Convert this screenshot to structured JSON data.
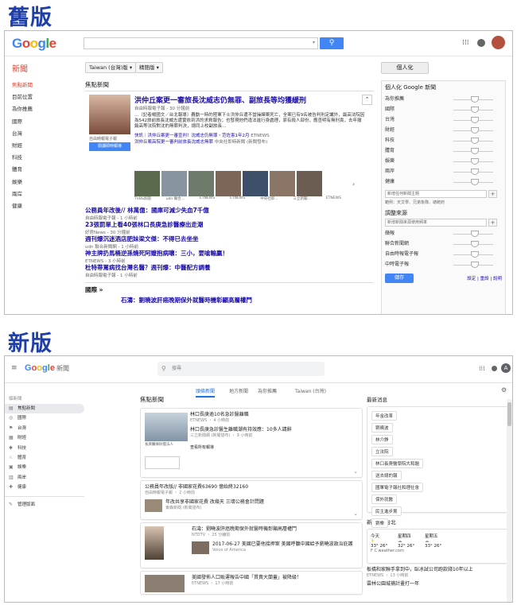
{
  "labels": {
    "old": "舊版",
    "new": "新版"
  },
  "old": {
    "logo": "Google",
    "news_label": "新聞",
    "edition": "Taiwan (台灣)版",
    "edition_mode": "精簡版",
    "personalize_btn": "個人化",
    "sidebar": [
      "焦點新聞",
      "目前位置",
      "為你推薦",
      "國際",
      "台灣",
      "財經",
      "科技",
      "體育",
      "娛樂",
      "兩岸",
      "健康"
    ],
    "top_heading": "焦點新聞",
    "lead": {
      "title": "洪仲丘案更一審旅長沈威志仍無罪、副旅長等均獲緩刑",
      "source": "自由時報電子報 - 30 分鐘前",
      "snippet": "...〔記者楊國文／台北報導〕轟動一時的陸軍下士洪仲丘遭不當操練案死亡，全案已有9名被告判刑定讞外，最高法院因為542旅前旅長沈威志遭實依到洪的求救報告；也發現他們違法進行身處理，原有殺人部份，應查明有無刑責，去年撤銷高等法院對沈的無罪判決，總同上校副旅長...",
      "photo_source": "自由時報電子報",
      "realtime_btn": "閱讀即時報導",
      "quick": "快訊｜洪仲丘案更一審宣判！沈威志仍無罪・范佐憲1年2月",
      "quick_src": "ETNEWS",
      "related": "洪仲丘案高院更一審判前旅長沈威志無罪",
      "related_src": "中央社即時新聞 (新聞發布)",
      "thumbs": [
        "TVBS新聞",
        "udn 聯合...",
        "ETNEWS",
        "ETNEWS",
        "中央社即...",
        "三立新聞...",
        "ETNEWS"
      ]
    },
    "stories": [
      {
        "title": "公務員年改後// 林萬億：國庫可減少失血7千億",
        "src": "自由時報電子報 - 1 小時前"
      },
      {
        "title": "23張罰單上看40張林口長庚急診醫療出走潮",
        "src": "好房News - 30 分鐘前"
      },
      {
        "title": "週刊爆沉迷酒店肥妹梁文傑：不得已去坐坐",
        "src": "udn 聯合新聞網 - 1 小時前"
      },
      {
        "title": "神主牌扔馬桶逆孫燒死阿嬤抱病嚷：三小，要嗆輸贏！",
        "src": "ETNEWS - 3 小時前"
      },
      {
        "title": "杜特蒂罵病找台灣名醫？週刊爆：中醫配方調養",
        "src": "自由時報電子報 - 1 小時前"
      }
    ],
    "intl_heading": "國際 »",
    "intl_story": "石濤：劉曉波肝癌晚期保外就醫時機彰顯高層權鬥",
    "personal_title": "個人化 Google 新聞",
    "sliders": [
      "為你推薦",
      "國際",
      "台灣",
      "財經",
      "科技",
      "體育",
      "娛樂",
      "兩岸",
      "健康"
    ],
    "add_topic_ph": "新增任何新聞主題",
    "add_topic_eg": "範例：天文學、兄弟象隊、總統府",
    "sources_title": "調整來源",
    "add_source_ph": "新增新聞來源使用頻率",
    "source_sliders": [
      "蘋報",
      "聯合新聞網",
      "自由時報電子報",
      "中時電子報"
    ],
    "save_btn": "儲存",
    "settings": "設定",
    "reset": "重設",
    "help": "說明"
  },
  "new": {
    "logo": "Google",
    "logo_sub": "新聞",
    "search_ph": "搜尋",
    "tabs": [
      "頭條新聞",
      "地方新聞",
      "為你推薦",
      "Taiwan (台灣)"
    ],
    "sidebar_caption": "個新聞",
    "sidebar": [
      "焦點新聞",
      "國際",
      "台灣",
      "財經",
      "科技",
      "體育",
      "娛樂",
      "兩岸",
      "健康"
    ],
    "manage": "管理版面",
    "heading": "焦點新聞",
    "cards": [
      {
        "title": "林口長庚逾10名急診醫離職",
        "src": "ETNEWS ・ 4 小時前",
        "sub": "林口長庚急診醫生離職潮有持效應：10多人請辭",
        "sub_src": "三立新聞網 (新聞發布) ・ 9 小時前",
        "more": "查看所有報導",
        "photo_cap": "長庚醫療財團法人"
      },
      {
        "title": "公務員年改版// 非國家花費63690 億始終32160",
        "src": "自由時報電子報 ・ 2 小時前",
        "sub": "年改共享非國家花費 改幾天 三壞公務會計問題",
        "sub_src": "東森新聞 (新聞發布)"
      },
      {
        "title": "石濤：劉曉波肝癌晚期保外就醫時機彰顯高層權鬥",
        "src": "NTDTV ・ 25 分鐘前",
        "sub": "2017-06-27 美國已要他接押案 美國呼籲中國給予劉曉波政治庇護",
        "sub_src": "Voice of America"
      },
      {
        "title": "美國發佈人口販運報告中國「貫責大蘭蓋」被降級！",
        "src": "ETNEWS ・ 17 小時前"
      }
    ],
    "latest_title": "最新消息",
    "latest": [
      "年金改革",
      "劉曉波",
      "林介錚",
      "立法院",
      "林口長庚醫學院大和題",
      "送去總的報",
      "國軍電子報社和理社會",
      "保外就醫",
      "民主進步黨",
      "劉樂"
    ],
    "weather_title": "新北市, 台北",
    "weather_days": [
      "今天",
      "星期四",
      "星期五"
    ],
    "weather_temps": [
      "33° 26°",
      "32° 26°",
      "33° 26°"
    ],
    "weather_unit": "F   C   weather.com",
    "bottom_news": "板橋和家聯手拿到中，臥冰試公司跑款錢10年以上",
    "bottom_src": "ETNEWS ・ 13 小時前",
    "bottom_news2": "雲林公園城捕計畫打一年"
  }
}
